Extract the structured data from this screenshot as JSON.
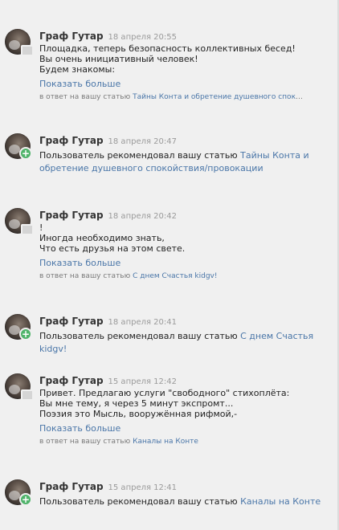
{
  "notifications": [
    {
      "author": "Граф Гутар",
      "date": "18 апреля 20:55",
      "lines": [
        "Площадка, теперь безопасность коллективных бесед!",
        "Вы очень инициативный человек!",
        "Будем знакомы:"
      ],
      "show_more": "Показать больше",
      "reply_prefix": "в ответ на вашу статью",
      "reply_link": "Тайны Конта и обретение душевного спокой..."
    },
    {
      "author": "Граф Гутар",
      "date": "18 апреля 20:47",
      "rec_prefix": "Пользователь рекомендовал вашу статью",
      "rec_link": "Тайны Конта и обретение душевного спокойствия/провокации"
    },
    {
      "author": "Граф Гутар",
      "date": "18 апреля 20:42",
      "lines": [
        "!",
        "Иногда необходимо знать,",
        "Что есть друзья на этом свете."
      ],
      "show_more": "Показать больше",
      "reply_prefix": "в ответ на вашу статью",
      "reply_link": "С днем Счастья kidgv!"
    },
    {
      "author": "Граф Гутар",
      "date": "18 апреля 20:41",
      "rec_prefix": "Пользователь рекомендовал вашу статью",
      "rec_link": "С днем Счастья kidgv!"
    },
    {
      "author": "Граф Гутар",
      "date": "15 апреля 12:42",
      "lines": [
        "Привет. Предлагаю услуги \"свободного\" стихоплёта:",
        "Вы мне тему, я через 5 минут экспромт...",
        "Поэзия это Мысль, вооружённая рифмой,-"
      ],
      "show_more": "Показать больше",
      "reply_prefix": "в ответ на вашу статью",
      "reply_link": "Каналы на Конте"
    },
    {
      "author": "Граф Гутар",
      "date": "15 апреля 12:41",
      "rec_prefix": "Пользователь рекомендовал вашу статью",
      "rec_link": "Каналы на Конте"
    }
  ]
}
